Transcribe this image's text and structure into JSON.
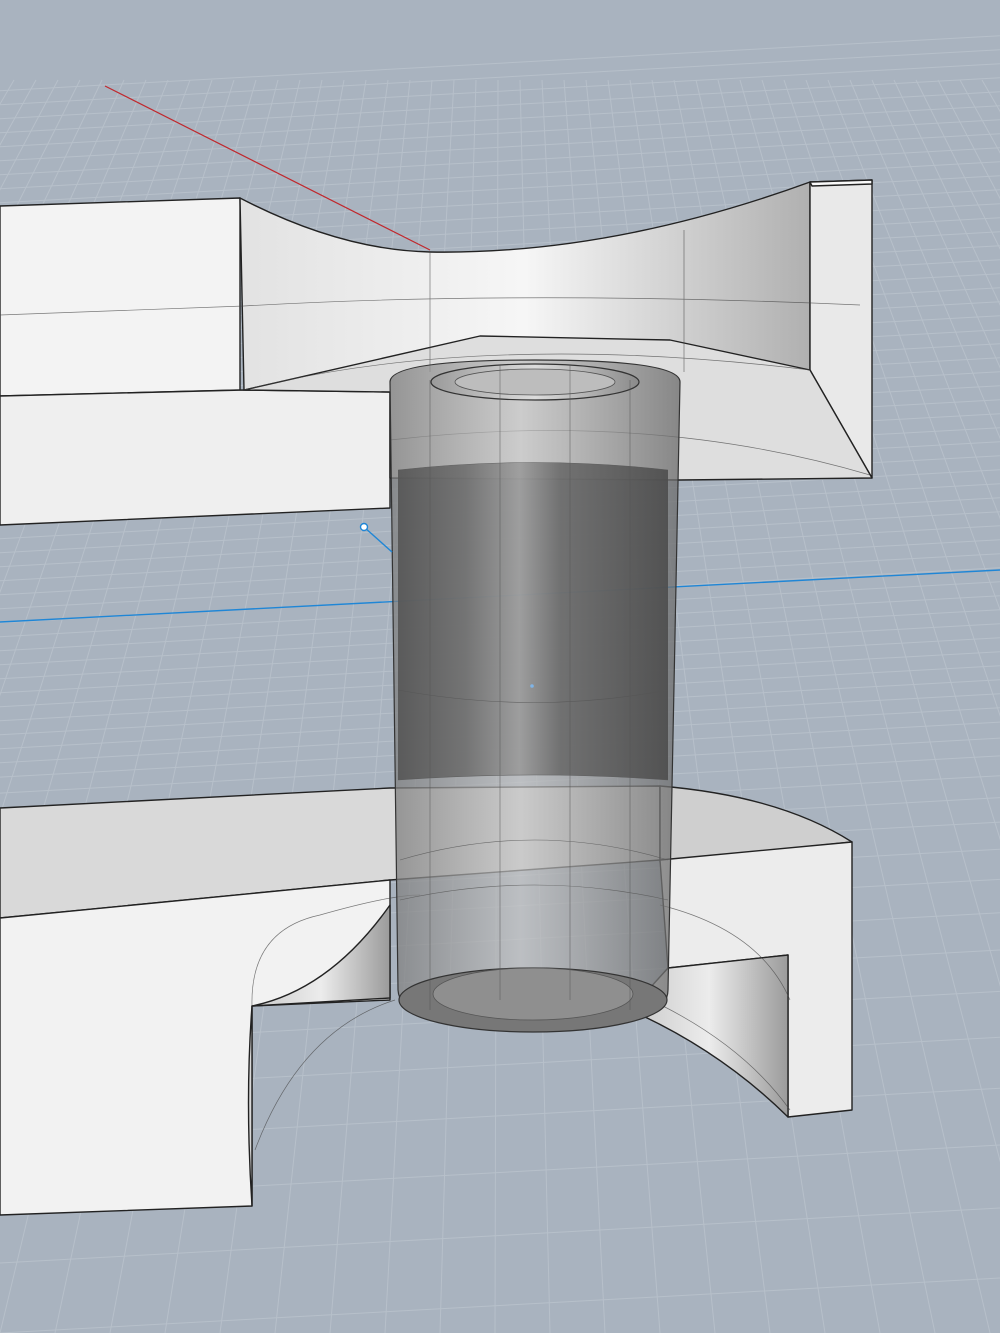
{
  "viewport": {
    "view_mode": "perspective",
    "display_mode": "shaded",
    "colors": {
      "background": "#a9b3bf",
      "grid_minor": "#b7c0ca",
      "grid_major": "#c4ccd5",
      "x_axis": "#c0282d",
      "y_axis": "#1f86d6",
      "model_light": "#f4f4f4",
      "model_shade": "#d6d6d6",
      "edge": "#222222",
      "tube_dark": "#5e5e5e",
      "tube_light": "#c8c8c8"
    },
    "objects": [
      {
        "name": "upper-flange",
        "kind": "solid"
      },
      {
        "name": "lower-flange",
        "kind": "solid"
      },
      {
        "name": "tube-sleeve",
        "kind": "cylinder",
        "transparent": true
      },
      {
        "name": "gumball-handle",
        "kind": "control-point"
      }
    ]
  }
}
